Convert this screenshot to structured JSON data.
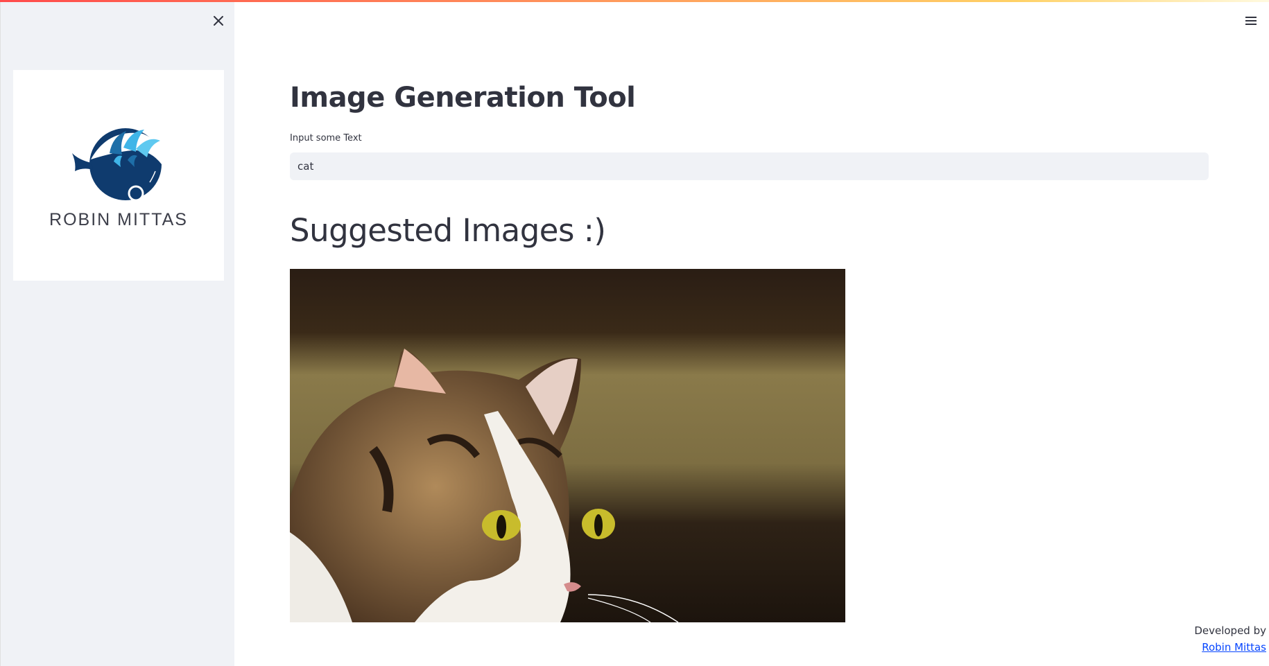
{
  "sidebar": {
    "close_icon": "close-icon",
    "logo": {
      "name": "ROBIN MITTAS",
      "icon": "whale-logo"
    }
  },
  "header": {
    "menu_icon": "hamburger-menu-icon"
  },
  "main": {
    "title": "Image Generation Tool",
    "input": {
      "label": "Input some Text",
      "value": "cat"
    },
    "section_title": "Suggested Images :)",
    "image": {
      "subject": "calico cat photo"
    }
  },
  "footer": {
    "text": "Developed by",
    "link": "Robin Mittas"
  },
  "colors": {
    "sidebar_bg": "#f0f2f6",
    "logo_blue": "#0f3b6e",
    "logo_light_blue": "#3fb5e8",
    "link_color": "#0645ff"
  }
}
